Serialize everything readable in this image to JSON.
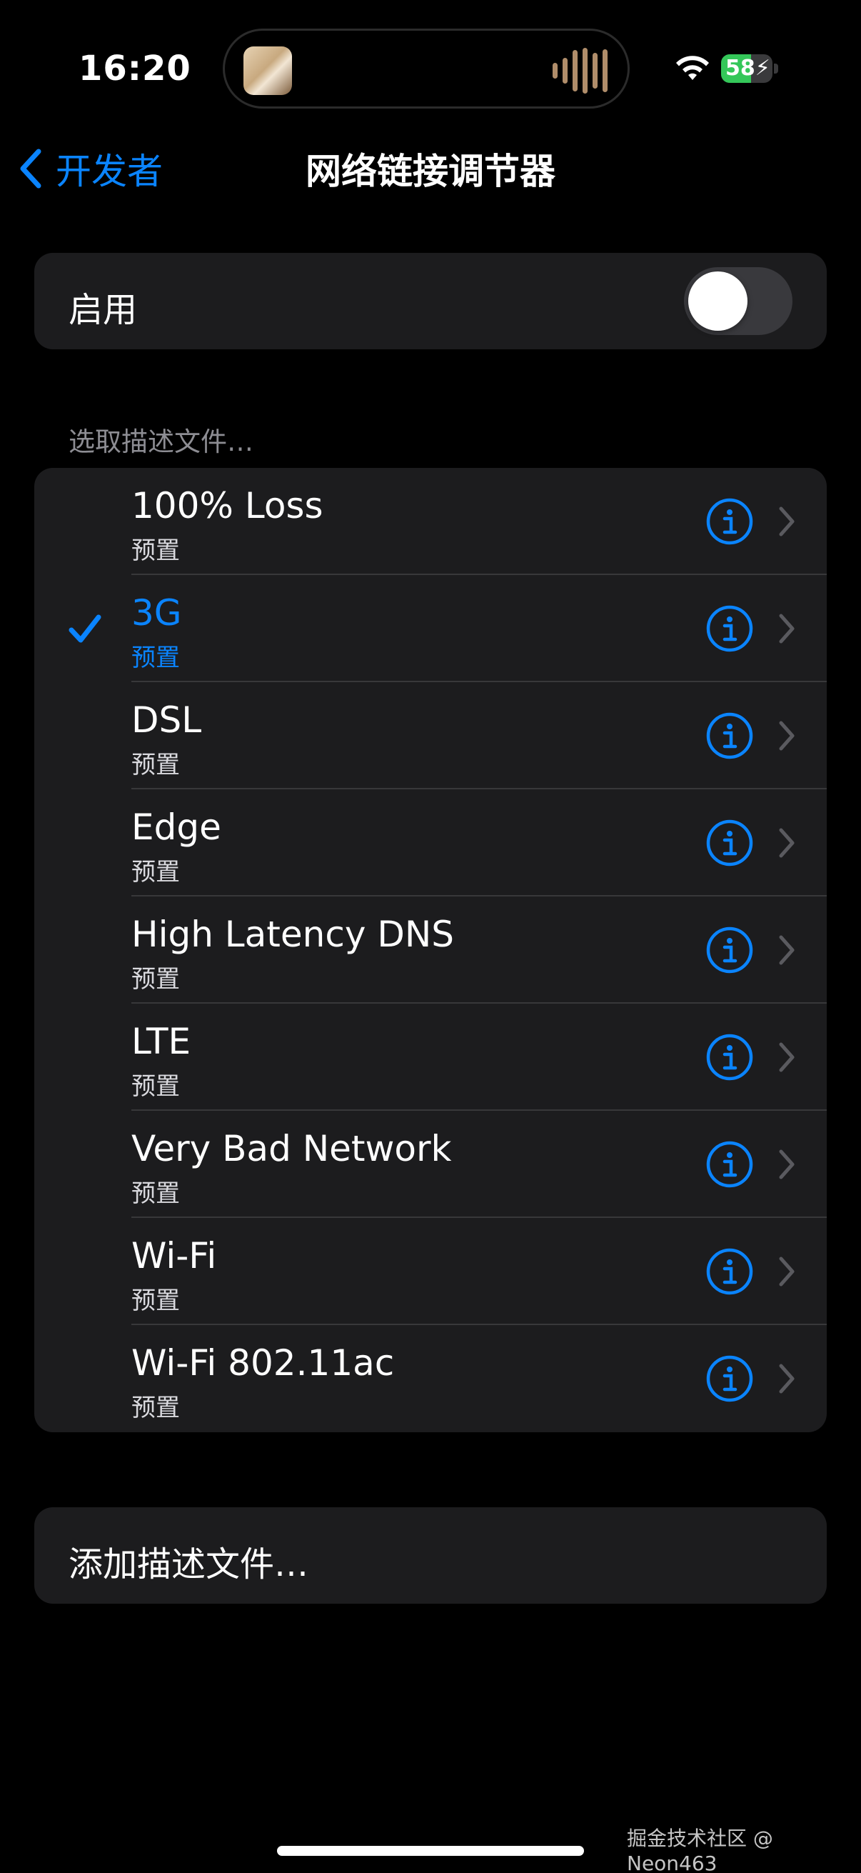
{
  "status_bar": {
    "time": "16:20",
    "battery_level": "58",
    "battery_fraction": 0.58,
    "icons": [
      "wifi-icon",
      "battery-charging-icon"
    ]
  },
  "nav": {
    "back_label": "开发者",
    "title": "网络链接调节器"
  },
  "enable": {
    "label": "启用",
    "on": false
  },
  "section_header": "选取描述文件…",
  "profiles": [
    {
      "title": "100% Loss",
      "subtitle": "预置",
      "selected": false
    },
    {
      "title": "3G",
      "subtitle": "预置",
      "selected": true
    },
    {
      "title": "DSL",
      "subtitle": "预置",
      "selected": false
    },
    {
      "title": "Edge",
      "subtitle": "预置",
      "selected": false
    },
    {
      "title": "High Latency DNS",
      "subtitle": "预置",
      "selected": false
    },
    {
      "title": "LTE",
      "subtitle": "预置",
      "selected": false
    },
    {
      "title": "Very Bad Network",
      "subtitle": "预置",
      "selected": false
    },
    {
      "title": "Wi-Fi",
      "subtitle": "预置",
      "selected": false
    },
    {
      "title": "Wi-Fi 802.11ac",
      "subtitle": "预置",
      "selected": false
    }
  ],
  "add_profile_label": "添加描述文件…",
  "watermark": "掘金技术社区 @ Neon463",
  "colors": {
    "accent": "#0a84ff",
    "background": "#000000",
    "group_bg": "#1c1c1e",
    "battery_green": "#34c759"
  }
}
